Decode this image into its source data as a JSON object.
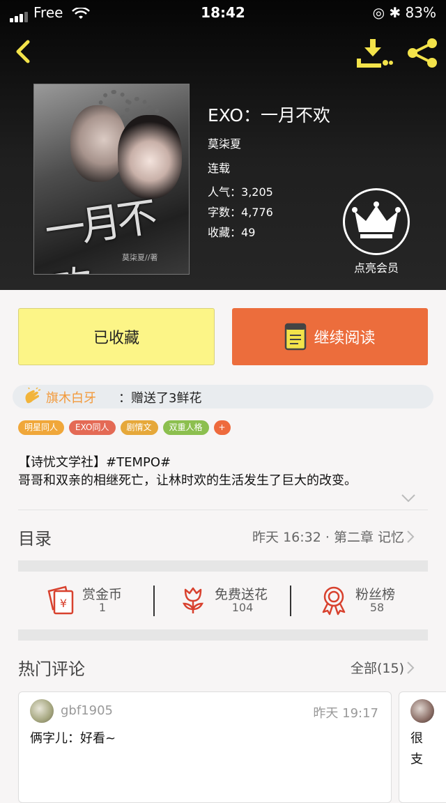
{
  "status_bar": {
    "carrier": "Free",
    "time": "18:42",
    "battery": "83%"
  },
  "book": {
    "title": "EXO：一月不欢",
    "author": "莫柒夏",
    "status": "连载",
    "popularity_label": "人气：",
    "popularity": "3,205",
    "word_count_label": "字数：",
    "word_count": "4,776",
    "favorites_label": "收藏：",
    "favorites": "49",
    "cover_title": "一月不欢",
    "cover_author": "莫柒夏//著"
  },
  "vip": {
    "label": "点亮会员"
  },
  "actions": {
    "favorited_label": "已收藏",
    "continue_label": "继续阅读"
  },
  "gift": {
    "user": "旗木白牙",
    "action": "：赠送了3鲜花"
  },
  "tags": [
    {
      "label": "明星同人",
      "color": "#f0a73a"
    },
    {
      "label": "EXO同人",
      "color": "#e46a55"
    },
    {
      "label": "剧情文",
      "color": "#e6a83a"
    },
    {
      "label": "双重人格",
      "color": "#8cbf4f"
    },
    {
      "label": "+",
      "color": "#ee6a3d"
    }
  ],
  "intro": {
    "line1": "【诗忧文学社】#TEMPO#",
    "line2": "哥哥和双亲的相继死亡，让林时欢的生活发生了巨大的改变。"
  },
  "toc": {
    "label": "目录",
    "latest": "昨天 16:32 · 第二章 记忆"
  },
  "stats": {
    "reward": {
      "label": "赏金币",
      "value": "1"
    },
    "flowers": {
      "label": "免费送花",
      "value": "104"
    },
    "fans": {
      "label": "粉丝榜",
      "value": "58"
    }
  },
  "comments": {
    "label": "热门评论",
    "all_label": "全部(15)",
    "items": [
      {
        "user": "gbf1905",
        "time": "昨天 19:17",
        "text": "俩字儿：好看~"
      },
      {
        "text1": "很",
        "text2": "支"
      }
    ]
  },
  "colors": {
    "accent": "#ec6d3c",
    "fav_bg": "#fcf587",
    "icon_yellow": "#f3e34a",
    "icon_red": "#d8412e"
  }
}
